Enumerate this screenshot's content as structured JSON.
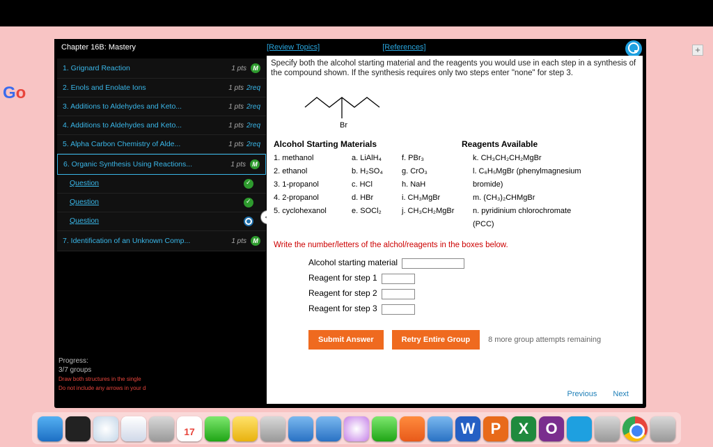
{
  "topbar": {},
  "browser": {
    "logo": "Go",
    "tab_plus": "+"
  },
  "chapter": {
    "title": "Chapter 16B: Mastery",
    "review": "[Review Topics]",
    "refs": "[References]"
  },
  "sidebar": {
    "items": [
      {
        "label": "1. Grignard Reaction",
        "pts": "1 pts",
        "req": "",
        "badge": "M"
      },
      {
        "label": "2. Enols and Enolate Ions",
        "pts": "1 pts",
        "req": "2req",
        "badge": ""
      },
      {
        "label": "3. Additions to Aldehydes and Keto...",
        "pts": "1 pts",
        "req": "2req",
        "badge": ""
      },
      {
        "label": "4. Additions to Aldehydes and Keto...",
        "pts": "1 pts",
        "req": "2req",
        "badge": ""
      },
      {
        "label": "5. Alpha Carbon Chemistry of Alde...",
        "pts": "1 pts",
        "req": "2req",
        "badge": ""
      },
      {
        "label": "6. Organic Synthesis Using Reactions...",
        "pts": "1 pts",
        "req": "",
        "badge": "M"
      },
      {
        "label": "7. Identification of an Unknown Comp...",
        "pts": "1 pts",
        "req": "",
        "badge": "M"
      }
    ],
    "questions": [
      {
        "label": "Question",
        "state": "green"
      },
      {
        "label": "Question",
        "state": "green"
      },
      {
        "label": "Question",
        "state": "blue"
      }
    ]
  },
  "progress": {
    "label": "Progress:",
    "value": "3/7 groups",
    "hint1": "Draw both structures in the single",
    "hint2": "Do not include any arrows in your d"
  },
  "question": {
    "instruction": "Specify both the alcohol starting material and the reagents you would use in each step in a synthesis of the compound shown. If the synthesis requires only two steps enter \"none\" for step 3.",
    "structure_label": "Br",
    "alcohol_title": "Alcohol Starting Materials",
    "reagents_title": "Reagents Available",
    "alcohols": [
      "1. methanol",
      "2. ethanol",
      "3. 1-propanol",
      "4. 2-propanol",
      "5. cyclohexanol"
    ],
    "reagents_col1": [
      "a. LiAlH₄",
      "b. H₂SO₄",
      "c. HCl",
      "d. HBr",
      "e. SOCl₂"
    ],
    "reagents_col2": [
      "f. PBr₃",
      "g. CrO₃",
      "h. NaH",
      "i. CH₃MgBr",
      "j. CH₃CH₂MgBr"
    ],
    "reagents_col3": [
      "k. CH₃CH₂CH₂MgBr",
      "l. C₆H₅MgBr (phenylmagnesium bromide)",
      "m. (CH₃)₂CHMgBr",
      "n. pyridinium chlorochromate (PCC)"
    ],
    "prompt_red": "Write the number/letters of the alchol/reagents in the boxes below.",
    "form": {
      "starting": "Alcohol starting material",
      "step1": "Reagent for step 1",
      "step2": "Reagent for step 2",
      "step3": "Reagent for step 3"
    },
    "submit": "Submit Answer",
    "retry": "Retry Entire Group",
    "remaining": "8 more group attempts remaining",
    "prev": "Previous",
    "next": "Next",
    "arrow": "<"
  },
  "dock": {
    "calendar_day": "17"
  }
}
